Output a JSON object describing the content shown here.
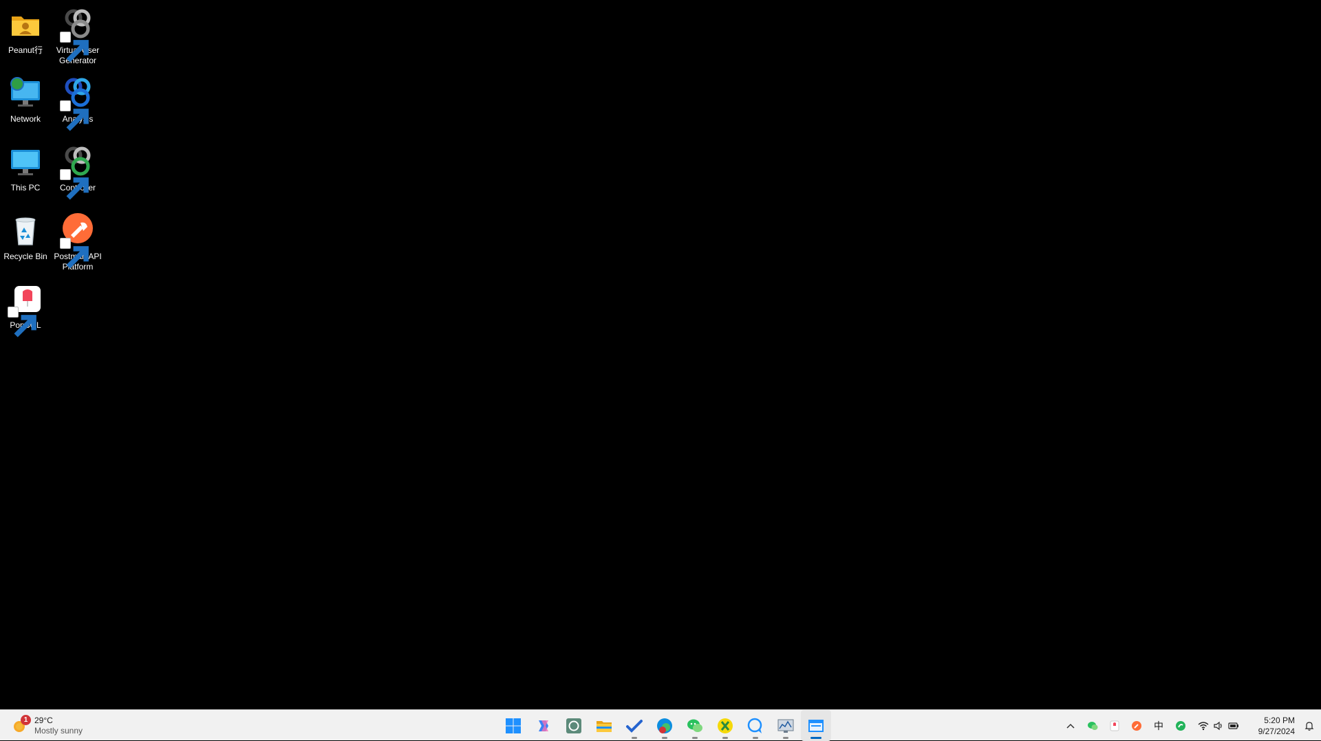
{
  "desktop": {
    "icons": [
      {
        "label": "Peanut行",
        "icon": "user-folder-icon"
      },
      {
        "label": "Virtual User Generator",
        "icon": "loadrunner-vugen-icon"
      },
      {
        "label": "Network",
        "icon": "network-icon"
      },
      {
        "label": "Analysis",
        "icon": "loadrunner-analysis-icon"
      },
      {
        "label": "This PC",
        "icon": "this-pc-icon"
      },
      {
        "label": "Controller",
        "icon": "loadrunner-controller-icon"
      },
      {
        "label": "Recycle Bin",
        "icon": "recycle-bin-icon"
      },
      {
        "label": "Postman API Platform",
        "icon": "postman-icon"
      },
      {
        "label": "PopSQL",
        "icon": "popsql-icon"
      }
    ]
  },
  "taskbar": {
    "weather": {
      "temp": "29°C",
      "desc": "Mostly sunny",
      "badge": "1"
    },
    "apps": [
      {
        "name": "start",
        "icon": "windows-start-icon",
        "running": false
      },
      {
        "name": "copilot",
        "icon": "copilot-icon",
        "running": false
      },
      {
        "name": "chatgpt",
        "icon": "chatgpt-icon",
        "running": false
      },
      {
        "name": "file-explorer",
        "icon": "folder-icon",
        "running": false
      },
      {
        "name": "todo",
        "icon": "checkmark-icon",
        "running": true
      },
      {
        "name": "edge",
        "icon": "edge-icon",
        "running": true
      },
      {
        "name": "wechat",
        "icon": "wechat-icon",
        "running": true
      },
      {
        "name": "app-yellow",
        "icon": "yellow-app-icon",
        "running": true
      },
      {
        "name": "chat",
        "icon": "chat-bubble-icon",
        "running": true
      },
      {
        "name": "perf-monitor",
        "icon": "monitor-chart-icon",
        "running": true
      },
      {
        "name": "app-active",
        "icon": "window-app-icon",
        "running": true,
        "active": true
      }
    ],
    "tray": {
      "ime": "中",
      "time": "5:20 PM",
      "date": "9/27/2024"
    },
    "colors": {
      "accent": "#0067c0",
      "taskbar_bg": "#f1f1f1"
    }
  }
}
